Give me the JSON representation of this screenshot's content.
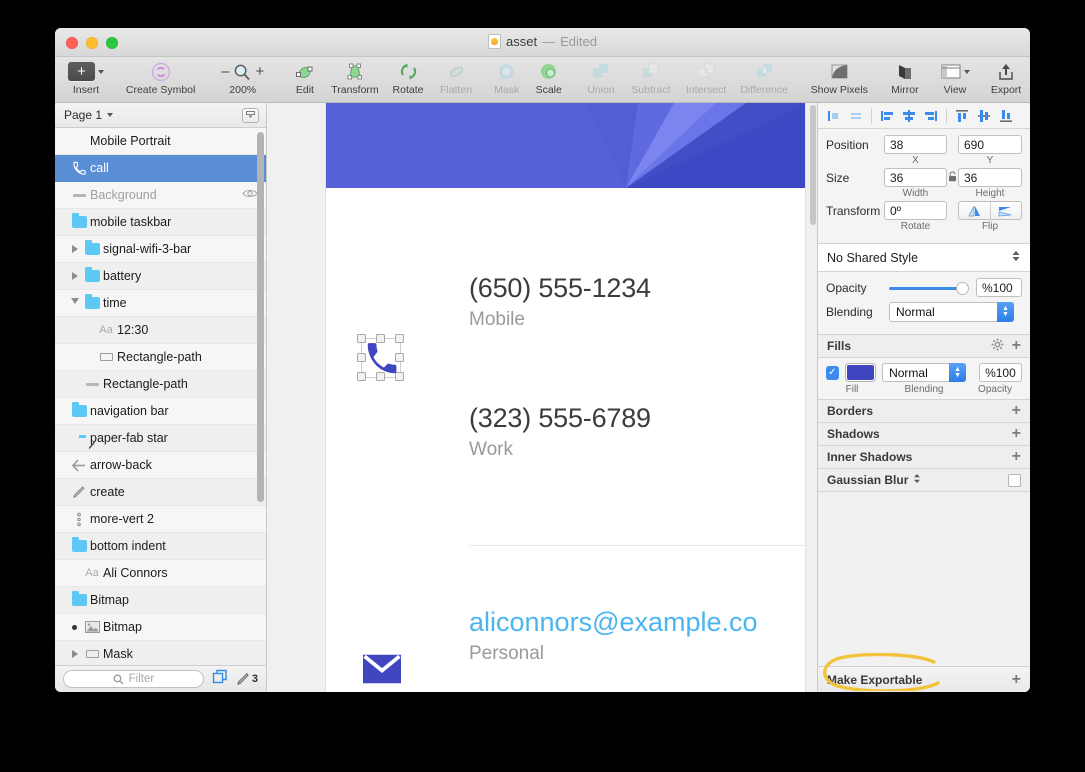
{
  "window": {
    "title_doc": "asset",
    "title_sep": "—",
    "title_state": "Edited"
  },
  "toolbar": {
    "items": [
      {
        "label": "Insert",
        "icon": "plus-button-icon",
        "enabled": true
      },
      {
        "label": "Create Symbol",
        "icon": "create-symbol-icon",
        "enabled": true
      },
      {
        "label": "200%",
        "icon": "zoom-magnifier-icon",
        "enabled": true
      },
      {
        "label": "Edit",
        "icon": "edit-vector-icon",
        "enabled": true
      },
      {
        "label": "Transform",
        "icon": "transform-icon",
        "enabled": true
      },
      {
        "label": "Rotate",
        "icon": "rotate-icon",
        "enabled": true
      },
      {
        "label": "Flatten",
        "icon": "flatten-icon",
        "enabled": false
      },
      {
        "label": "Mask",
        "icon": "mask-icon",
        "enabled": false
      },
      {
        "label": "Scale",
        "icon": "scale-icon",
        "enabled": true
      },
      {
        "label": "Union",
        "icon": "union-icon",
        "enabled": false
      },
      {
        "label": "Subtract",
        "icon": "subtract-icon",
        "enabled": false
      },
      {
        "label": "Intersect",
        "icon": "intersect-icon",
        "enabled": false
      },
      {
        "label": "Difference",
        "icon": "difference-icon",
        "enabled": false
      },
      {
        "label": "Show Pixels",
        "icon": "show-pixels-icon",
        "enabled": true
      },
      {
        "label": "Mirror",
        "icon": "mirror-icon",
        "enabled": true
      },
      {
        "label": "View",
        "icon": "view-icon",
        "enabled": true
      },
      {
        "label": "Export",
        "icon": "export-arrow-icon",
        "enabled": true
      }
    ],
    "zoom_minus": "–",
    "zoom_plus": "+"
  },
  "sidebar": {
    "page_label": "Page 1",
    "layers": [
      {
        "name": "Mobile Portrait",
        "indent": 0,
        "icon": "none",
        "disclosure": "none",
        "selected": false,
        "dim": false,
        "eye": false
      },
      {
        "name": "call",
        "indent": 0,
        "icon": "phone",
        "disclosure": "none",
        "selected": true,
        "dim": false,
        "eye": false
      },
      {
        "name": "Background",
        "indent": 0,
        "icon": "dash",
        "disclosure": "none",
        "selected": false,
        "dim": true,
        "eye": true
      },
      {
        "name": "mobile taskbar",
        "indent": 0,
        "icon": "folder",
        "disclosure": "none",
        "selected": false,
        "dim": false,
        "eye": false
      },
      {
        "name": "signal-wifi-3-bar",
        "indent": 1,
        "icon": "folder",
        "disclosure": "closed",
        "selected": false,
        "dim": false,
        "eye": false
      },
      {
        "name": "battery",
        "indent": 1,
        "icon": "folder",
        "disclosure": "closed",
        "selected": false,
        "dim": false,
        "eye": false
      },
      {
        "name": "time",
        "indent": 1,
        "icon": "folder",
        "disclosure": "open",
        "selected": false,
        "dim": false,
        "eye": false
      },
      {
        "name": "12:30",
        "indent": 2,
        "icon": "text",
        "disclosure": "none",
        "selected": false,
        "dim": false,
        "eye": false
      },
      {
        "name": "Rectangle-path",
        "indent": 2,
        "icon": "rect",
        "disclosure": "none",
        "selected": false,
        "dim": false,
        "eye": false
      },
      {
        "name": "Rectangle-path",
        "indent": 1,
        "icon": "dash",
        "disclosure": "none",
        "selected": false,
        "dim": false,
        "eye": false
      },
      {
        "name": "navigation bar",
        "indent": 0,
        "icon": "folder",
        "disclosure": "none",
        "selected": false,
        "dim": false,
        "eye": false
      },
      {
        "name": "paper-fab star",
        "indent": 0,
        "icon": "folder-pen",
        "disclosure": "none",
        "selected": false,
        "dim": false,
        "eye": false
      },
      {
        "name": "arrow-back",
        "indent": 0,
        "icon": "arrow-back",
        "disclosure": "none",
        "selected": false,
        "dim": false,
        "eye": false
      },
      {
        "name": "create",
        "indent": 0,
        "icon": "pencil",
        "disclosure": "none",
        "selected": false,
        "dim": false,
        "eye": false
      },
      {
        "name": "more-vert 2",
        "indent": 0,
        "icon": "more-vert",
        "disclosure": "none",
        "selected": false,
        "dim": false,
        "eye": false
      },
      {
        "name": "bottom indent",
        "indent": 0,
        "icon": "folder",
        "disclosure": "none",
        "selected": false,
        "dim": false,
        "eye": false
      },
      {
        "name": "Ali Connors",
        "indent": 1,
        "icon": "text",
        "disclosure": "none",
        "selected": false,
        "dim": false,
        "eye": false
      },
      {
        "name": "Bitmap",
        "indent": 0,
        "icon": "folder",
        "disclosure": "none",
        "selected": false,
        "dim": false,
        "eye": false
      },
      {
        "name": "Bitmap",
        "indent": 1,
        "icon": "bitmap",
        "disclosure": "dot",
        "selected": false,
        "dim": false,
        "eye": false
      },
      {
        "name": "Mask",
        "indent": 1,
        "icon": "rect",
        "disclosure": "closed",
        "selected": false,
        "dim": false,
        "eye": false
      }
    ],
    "filter_placeholder": "Filter",
    "pencil_count": "3"
  },
  "canvas": {
    "contacts": [
      {
        "value": "(650) 555-1234",
        "label": "Mobile",
        "type": "phone"
      },
      {
        "value": "(323) 555-6789",
        "label": "Work",
        "type": "phone"
      },
      {
        "value": "aliconnors@example.co",
        "label": "Personal",
        "type": "email"
      }
    ],
    "banner_color": "#5661d8"
  },
  "inspector": {
    "align_buttons": [
      "align-left-icon",
      "align-center-horizontal-icon",
      "distribute-left-icon",
      "distribute-center-icon",
      "distribute-right-icon",
      "align-top-icon",
      "align-middle-icon",
      "align-bottom-icon"
    ],
    "position": {
      "label": "Position",
      "x": "38",
      "y": "690",
      "x_cap": "X",
      "y_cap": "Y"
    },
    "size": {
      "label": "Size",
      "width": "36",
      "height": "36",
      "w_cap": "Width",
      "h_cap": "Height"
    },
    "transform": {
      "label": "Transform",
      "rotate": "0º",
      "rotate_cap": "Rotate",
      "flip_cap": "Flip"
    },
    "shared_style": "No Shared Style",
    "opacity": {
      "label": "Opacity",
      "value": "%100",
      "percent": 100
    },
    "blending": {
      "label": "Blending",
      "value": "Normal"
    },
    "fills": {
      "title": "Fills",
      "color": "#3f46bf",
      "blending": "Normal",
      "opacity": "%100",
      "cap_fill": "Fill",
      "cap_blending": "Blending",
      "cap_opacity": "Opacity"
    },
    "borders_title": "Borders",
    "shadows_title": "Shadows",
    "inner_shadows_title": "Inner Shadows",
    "gaussian_blur_title": "Gaussian Blur",
    "make_exportable": "Make Exportable",
    "highlight_color": "#f2c43d"
  }
}
